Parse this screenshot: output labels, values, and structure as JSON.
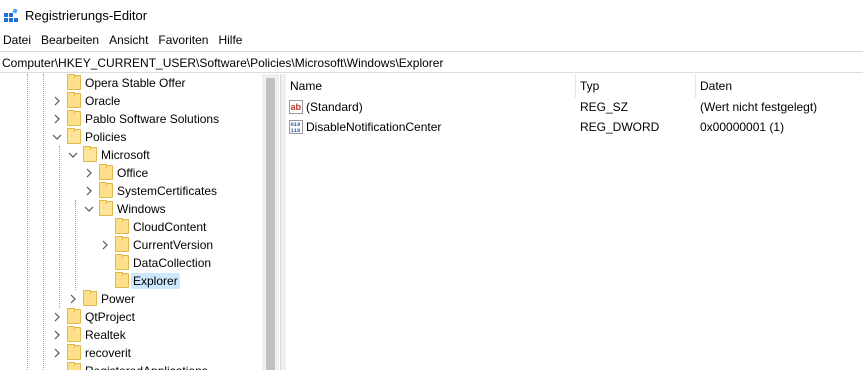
{
  "window": {
    "title": "Registrierungs-Editor",
    "icon": "registry-editor-icon"
  },
  "menu": {
    "items": [
      "Datei",
      "Bearbeiten",
      "Ansicht",
      "Favoriten",
      "Hilfe"
    ]
  },
  "address": {
    "value": "Computer\\HKEY_CURRENT_USER\\Software\\Policies\\Microsoft\\Windows\\Explorer"
  },
  "tree": {
    "rows": [
      {
        "label": "Opera Stable Offer",
        "level": 0,
        "expander": "none",
        "selected": false
      },
      {
        "label": "Oracle",
        "level": 0,
        "expander": "collapsed",
        "selected": false
      },
      {
        "label": "Pablo Software Solutions",
        "level": 0,
        "expander": "collapsed",
        "selected": false
      },
      {
        "label": "Policies",
        "level": 0,
        "expander": "expanded",
        "selected": false
      },
      {
        "label": "Microsoft",
        "level": 1,
        "expander": "expanded",
        "selected": false
      },
      {
        "label": "Office",
        "level": 2,
        "expander": "collapsed",
        "selected": false
      },
      {
        "label": "SystemCertificates",
        "level": 2,
        "expander": "collapsed",
        "selected": false
      },
      {
        "label": "Windows",
        "level": 2,
        "expander": "expanded",
        "selected": false
      },
      {
        "label": "CloudContent",
        "level": 3,
        "expander": "none",
        "selected": false
      },
      {
        "label": "CurrentVersion",
        "level": 3,
        "expander": "collapsed",
        "selected": false
      },
      {
        "label": "DataCollection",
        "level": 3,
        "expander": "none",
        "selected": false
      },
      {
        "label": "Explorer",
        "level": 3,
        "expander": "none",
        "selected": true
      },
      {
        "label": "Power",
        "level": 1,
        "expander": "collapsed",
        "selected": false
      },
      {
        "label": "QtProject",
        "level": 0,
        "expander": "collapsed",
        "selected": false
      },
      {
        "label": "Realtek",
        "level": 0,
        "expander": "collapsed",
        "selected": false
      },
      {
        "label": "recoverit",
        "level": 0,
        "expander": "collapsed",
        "selected": false
      },
      {
        "label": "RegisteredApplications",
        "level": 0,
        "expander": "none",
        "selected": false
      }
    ]
  },
  "list": {
    "columns": {
      "name": "Name",
      "type": "Typ",
      "data": "Daten"
    },
    "rows": [
      {
        "name": "(Standard)",
        "type": "REG_SZ",
        "data": "(Wert nicht festgelegt)",
        "icon": "string-value-icon"
      },
      {
        "name": "DisableNotificationCenter",
        "type": "REG_DWORD",
        "data": "0x00000001 (1)",
        "icon": "binary-value-icon"
      }
    ]
  },
  "colors": {
    "selection": "#cce8ff",
    "folder": "#ffe08a",
    "string_icon": "#c0392b",
    "binary_icon": "#2a5caa"
  }
}
